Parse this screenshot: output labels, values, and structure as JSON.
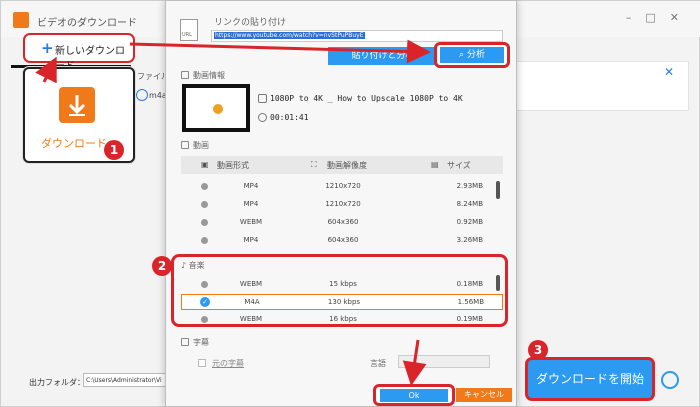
{
  "app": {
    "title": "ビデオのダウンロード",
    "new_download": "新しいダウンロード",
    "file_name_label": "ファイル名",
    "row_format": "m4a",
    "download_tile_label": "ダウンロード",
    "output_folder_label": "出力フォルダ：",
    "output_folder_value": "C:\\Users\\Administrator\\Vi",
    "start_download": "ダウンロードを開始"
  },
  "badges": [
    "1",
    "2",
    "3"
  ],
  "dialog": {
    "url_label": "リンクの貼り付け",
    "url_value": "https://www.youtube.com/watch?v=nvStPuPBuyE",
    "doc_icon_text": "URL",
    "paste_button": "貼り付けと分析",
    "analyze_button": "分析",
    "video_info_header": "動画情報",
    "video_title": "1080P to 4K _ How to Upscale 1080P to 4K",
    "video_duration": "00:01:41",
    "video_header": "動画",
    "columns": {
      "format": "動画形式",
      "resolution": "動画解像度",
      "size": "サイズ"
    },
    "video_rows": [
      {
        "format": "MP4",
        "resolution": "1210x720",
        "size": "2.93MB"
      },
      {
        "format": "MP4",
        "resolution": "1210x720",
        "size": "8.24MB"
      },
      {
        "format": "WEBM",
        "resolution": "604x360",
        "size": "0.92MB"
      },
      {
        "format": "MP4",
        "resolution": "604x360",
        "size": "3.26MB"
      }
    ],
    "audio_header": "音楽",
    "audio_rows": [
      {
        "format": "WEBM",
        "bitrate": "15 kbps",
        "size": "0.18MB"
      },
      {
        "format": "M4A",
        "bitrate": "130 kbps",
        "size": "1.56MB",
        "selected": true
      },
      {
        "format": "WEBM",
        "bitrate": "16 kbps",
        "size": "0.19MB"
      }
    ],
    "subtitle_header": "字幕",
    "subtitle_check_label": "元の字幕",
    "language_label": "言語",
    "ok_button": "Ok",
    "cancel_button": "キャンセル"
  },
  "colors": {
    "accent_blue": "#2c9af0",
    "accent_orange": "#f07a1a",
    "highlight_red": "#d9252a"
  }
}
